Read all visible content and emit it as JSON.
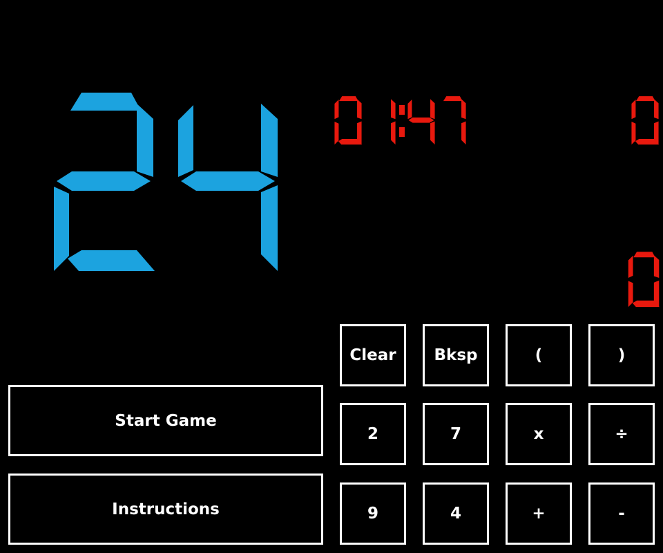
{
  "game": {
    "target_number": "24",
    "timer": "01:47",
    "score_top": "0",
    "score_bottom": "0"
  },
  "colors": {
    "target": "#1ca3df",
    "timer": "#e8190e",
    "button_border": "#ffffff",
    "background": "#000000"
  },
  "menu": {
    "start_label": "Start Game",
    "instructions_label": "Instructions"
  },
  "keypad": {
    "clear": "Clear",
    "bksp": "Bksp",
    "open_paren": "(",
    "close_paren": ")",
    "card1": "2",
    "card2": "7",
    "multiply": "x",
    "divide": "÷",
    "card3": "9",
    "card4": "4",
    "plus": "+",
    "minus": "-"
  }
}
